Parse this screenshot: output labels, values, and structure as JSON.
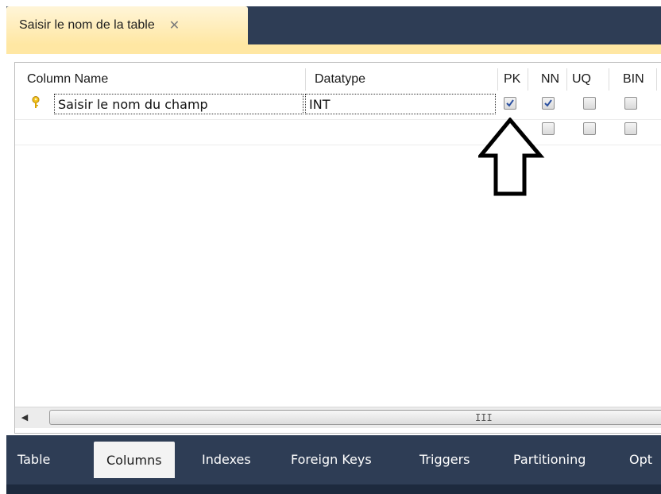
{
  "document_tab": {
    "label": "Saisir le nom de la table",
    "close_glyph": "✕"
  },
  "table": {
    "headers": [
      "Column Name",
      "Datatype",
      "PK",
      "NN",
      "UQ",
      "BIN"
    ],
    "rows": [
      {
        "column_name": "Saisir le nom du champ",
        "datatype": "INT",
        "pk": true,
        "nn": true,
        "uq": false,
        "bin": false,
        "key_icon": "primary-key-icon"
      },
      {
        "column_name": "",
        "datatype": "",
        "pk": false,
        "nn": false,
        "uq": false,
        "bin": false
      }
    ]
  },
  "scrollbar": {
    "left_arrow": "◀",
    "grip": "III"
  },
  "bottom_tabs": [
    "Table",
    "Columns",
    "Indexes",
    "Foreign Keys",
    "Triggers",
    "Partitioning",
    "Opt"
  ],
  "active_bottom_tab": "Columns",
  "annotation": {
    "icon": "up-arrow-outline-icon"
  },
  "colors": {
    "tabbar": "#2e3d55",
    "active_doc_tab": "#ffe7a3",
    "checkbox_check": "#2a4fa0"
  }
}
